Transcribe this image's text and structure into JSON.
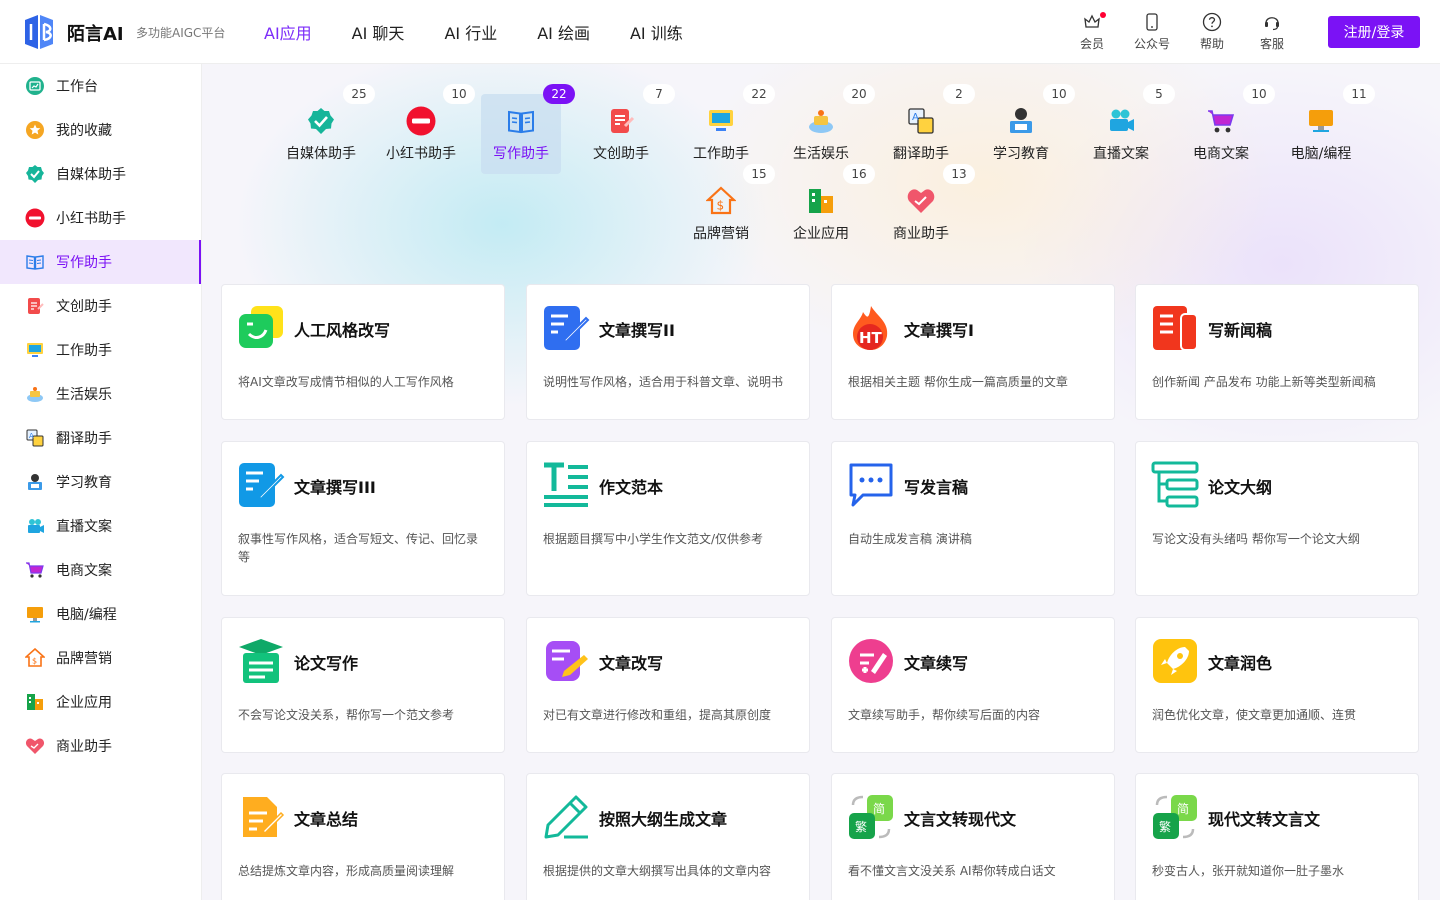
{
  "header": {
    "brand": "陌言AI",
    "slogan": "多功能AIGC平台",
    "nav": [
      "AI应用",
      "AI 聊天",
      "AI 行业",
      "AI 绘画",
      "AI 训练"
    ],
    "icons": [
      {
        "label": "会员",
        "icon": "crown-icon"
      },
      {
        "label": "公众号",
        "icon": "phone-icon"
      },
      {
        "label": "帮助",
        "icon": "help-icon"
      },
      {
        "label": "客服",
        "icon": "headset-icon"
      }
    ],
    "login": "注册/登录"
  },
  "sidebar": [
    {
      "label": "工作台",
      "icon": "dashboard-icon"
    },
    {
      "label": "我的收藏",
      "icon": "star-icon"
    },
    {
      "label": "自媒体助手",
      "icon": "verified-icon"
    },
    {
      "label": "小红书助手",
      "icon": "xiaohongshu-icon"
    },
    {
      "label": "写作助手",
      "icon": "book-icon"
    },
    {
      "label": "文创助手",
      "icon": "note-icon"
    },
    {
      "label": "工作助手",
      "icon": "monitor-icon"
    },
    {
      "label": "生活娱乐",
      "icon": "cake-icon"
    },
    {
      "label": "翻译助手",
      "icon": "translate-icon"
    },
    {
      "label": "学习教育",
      "icon": "student-icon"
    },
    {
      "label": "直播文案",
      "icon": "camera-icon"
    },
    {
      "label": "电商文案",
      "icon": "cart-icon"
    },
    {
      "label": "电脑/编程",
      "icon": "computer-icon"
    },
    {
      "label": "品牌营销",
      "icon": "money-house-icon"
    },
    {
      "label": "企业应用",
      "icon": "building-icon"
    },
    {
      "label": "商业助手",
      "icon": "handshake-icon"
    }
  ],
  "categories": [
    {
      "label": "自媒体助手",
      "count": "25",
      "icon": "verified-icon"
    },
    {
      "label": "小红书助手",
      "count": "10",
      "icon": "xiaohongshu-icon"
    },
    {
      "label": "写作助手",
      "count": "22",
      "icon": "book-icon"
    },
    {
      "label": "文创助手",
      "count": "7",
      "icon": "note-icon"
    },
    {
      "label": "工作助手",
      "count": "22",
      "icon": "monitor-icon"
    },
    {
      "label": "生活娱乐",
      "count": "20",
      "icon": "cake-icon"
    },
    {
      "label": "翻译助手",
      "count": "2",
      "icon": "translate-icon"
    },
    {
      "label": "学习教育",
      "count": "10",
      "icon": "student-icon"
    },
    {
      "label": "直播文案",
      "count": "5",
      "icon": "camera-icon"
    },
    {
      "label": "电商文案",
      "count": "10",
      "icon": "cart-icon"
    },
    {
      "label": "电脑/编程",
      "count": "11",
      "icon": "computer-icon"
    },
    {
      "label": "品牌营销",
      "count": "15",
      "icon": "money-house-icon"
    },
    {
      "label": "企业应用",
      "count": "16",
      "icon": "building-icon"
    },
    {
      "label": "商业助手",
      "count": "13",
      "icon": "handshake-icon"
    }
  ],
  "cards": [
    {
      "title": "人工风格改写",
      "desc": "将AI文章改写成情节相似的人工写作风格",
      "icon": "chat-smile-icon"
    },
    {
      "title": "文章撰写II",
      "desc": "说明性写作风格，适合用于科普文章、说明书",
      "icon": "edit-doc-blue-icon"
    },
    {
      "title": "文章撰写I",
      "desc": "根据相关主题 帮你生成一篇高质量的文章",
      "icon": "hot-flame-icon"
    },
    {
      "title": "写新闻稿",
      "desc": "创作新闻 产品发布 功能上新等类型新闻稿",
      "icon": "news-doc-icon"
    },
    {
      "title": "文章撰写III",
      "desc": "叙事性写作风格，适合写短文、传记、回忆录等",
      "icon": "edit-doc-cyan-icon"
    },
    {
      "title": "作文范本",
      "desc": "根据题目撰写中小学生作文范文/仅供参考",
      "icon": "text-format-icon"
    },
    {
      "title": "写发言稿",
      "desc": "自动生成发言稿 演讲稿",
      "icon": "speech-bubble-icon"
    },
    {
      "title": "论文大纲",
      "desc": "写论文没有头绪吗 帮你写一个论文大纲",
      "icon": "outline-tree-icon"
    },
    {
      "title": "论文写作",
      "desc": "不会写论文没关系，帮你写一个范文参考",
      "icon": "graduation-doc-icon"
    },
    {
      "title": "文章改写",
      "desc": "对已有文章进行修改和重组，提高其原创度",
      "icon": "rewrite-icon"
    },
    {
      "title": "文章续写",
      "desc": "文章续写助手，帮你续写后面的内容",
      "icon": "continue-write-icon"
    },
    {
      "title": "文章润色",
      "desc": "润色优化文章，使文章更加通顺、连贯",
      "icon": "rocket-icon"
    },
    {
      "title": "文章总结",
      "desc": "总结提炼文章内容，形成高质量阅读理解",
      "icon": "summary-doc-icon"
    },
    {
      "title": "按照大纲生成文章",
      "desc": "根据提供的文章大纲撰写出具体的文章内容",
      "icon": "pen-icon"
    },
    {
      "title": "文言文转现代文",
      "desc": "看不懂文言文没关系 AI帮你转成白话文",
      "icon": "convert-icon"
    },
    {
      "title": "现代文转文言文",
      "desc": "秒变古人，张开就知道你一肚子墨水",
      "icon": "convert-icon"
    }
  ]
}
